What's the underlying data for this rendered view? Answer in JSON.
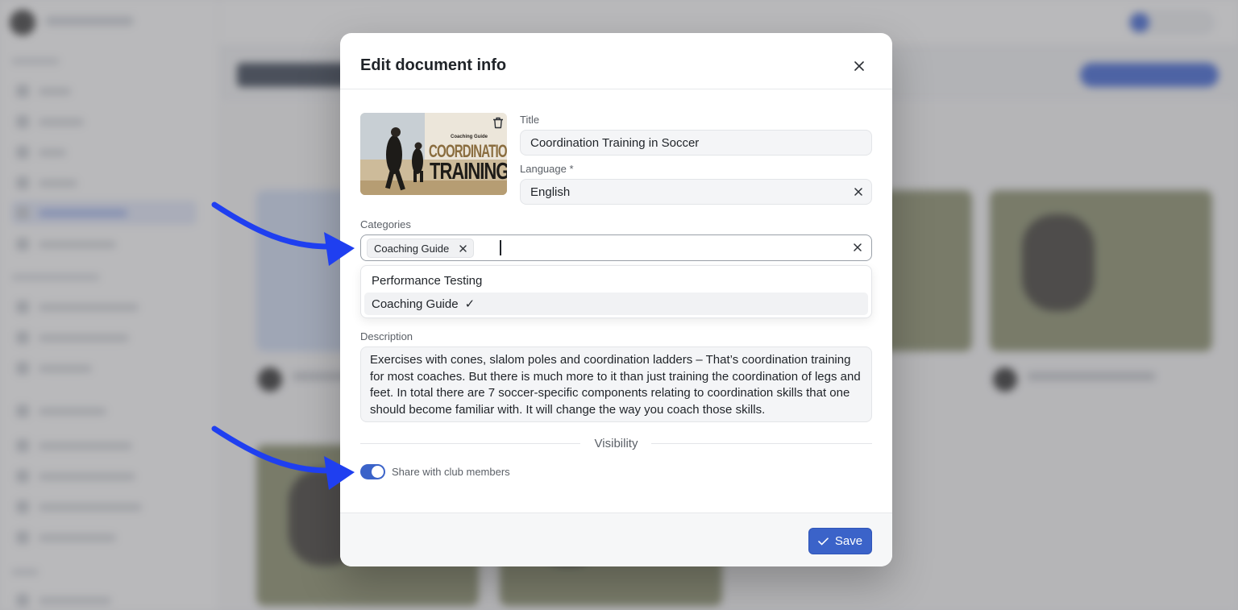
{
  "modal": {
    "title": "Edit document info",
    "thumbnail": {
      "kicker": "Coaching Guide",
      "headline_1": "COORDINATION",
      "headline_2": "TRAINING"
    },
    "title_field": {
      "label": "Title",
      "value": "Coordination Training in Soccer"
    },
    "language_field": {
      "label": "Language *",
      "value": "English"
    },
    "categories_field": {
      "label": "Categories",
      "selected_chips": [
        "Coaching Guide"
      ],
      "options": [
        {
          "label": "Performance Testing",
          "selected": false
        },
        {
          "label": "Coaching Guide",
          "selected": true
        }
      ],
      "check_glyph": "✓"
    },
    "description_field": {
      "label": "Description",
      "value": "Exercises with cones, slalom poles and coordination ladders – That’s coordination training for most coaches. But there is much more to it than just training the coordination of legs and feet. In total there are 7 soccer-specific components relating to coordination skills that one should become familiar with. It will change the way you coach those skills."
    },
    "visibility": {
      "divider_label": "Visibility",
      "share_toggle": {
        "label": "Share with club members",
        "on": true
      }
    },
    "save_label": "Save"
  },
  "colors": {
    "accent": "#3b63c9",
    "annotation_arrow": "#1f3ff0",
    "overlay": "rgba(100,100,104,0.45)"
  },
  "icons": [
    "close-icon",
    "trash-icon",
    "check-icon"
  ]
}
